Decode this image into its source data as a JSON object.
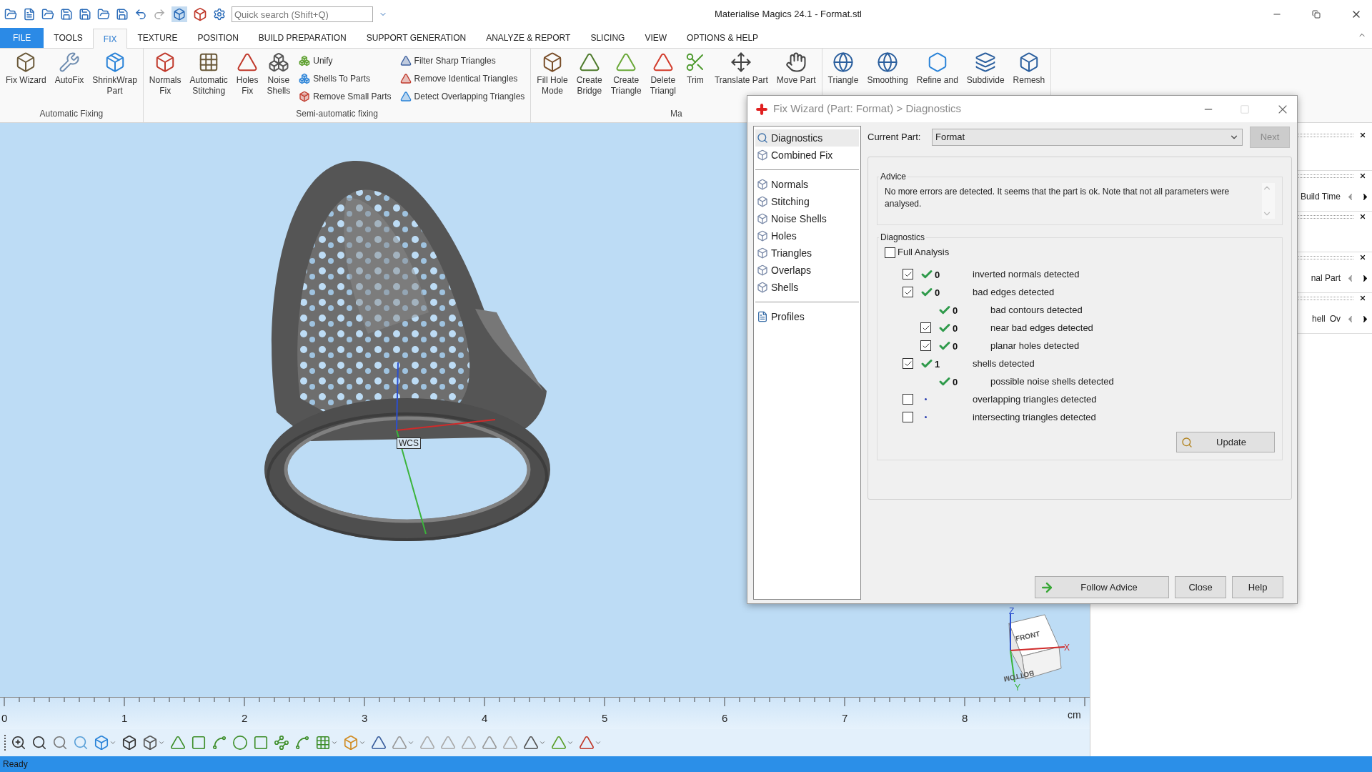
{
  "window": {
    "title": "Materialise Magics 24.1 - Format.stl"
  },
  "quick_search": {
    "placeholder": "Quick search (Shift+Q)"
  },
  "ribbon_tabs": [
    {
      "label": "FILE",
      "kind": "file",
      "selected": false
    },
    {
      "label": "TOOLS",
      "kind": "tab",
      "selected": false
    },
    {
      "label": "FIX",
      "kind": "tab",
      "selected": true
    },
    {
      "label": "TEXTURE",
      "kind": "tab",
      "selected": false
    },
    {
      "label": "POSITION",
      "kind": "tab",
      "selected": false
    },
    {
      "label": "BUILD PREPARATION",
      "kind": "tab",
      "selected": false
    },
    {
      "label": "SUPPORT GENERATION",
      "kind": "tab",
      "selected": false
    },
    {
      "label": "ANALYZE & REPORT",
      "kind": "tab",
      "selected": false
    },
    {
      "label": "SLICING",
      "kind": "tab",
      "selected": false
    },
    {
      "label": "VIEW",
      "kind": "tab",
      "selected": false
    },
    {
      "label": "OPTIONS & HELP",
      "kind": "tab",
      "selected": false
    }
  ],
  "ribbon_groups": [
    {
      "label": "Automatic Fixing",
      "items": [
        {
          "kind": "large",
          "label": "Fix Wizard"
        },
        {
          "kind": "large",
          "label": "AutoFix"
        },
        {
          "kind": "large",
          "label": "ShrinkWrap\nPart"
        }
      ]
    },
    {
      "label": "Semi-automatic fixing",
      "items": [
        {
          "kind": "large",
          "label": "Normals\nFix"
        },
        {
          "kind": "large",
          "label": "Automatic\nStitching"
        },
        {
          "kind": "large",
          "label": "Holes\nFix"
        },
        {
          "kind": "large",
          "label": "Noise\nShells"
        },
        {
          "kind": "small",
          "label": "Unify"
        },
        {
          "kind": "small",
          "label": "Shells To Parts"
        },
        {
          "kind": "small",
          "label": "Remove Small Parts"
        },
        {
          "kind": "small",
          "label": "Filter Sharp Triangles"
        },
        {
          "kind": "small",
          "label": "Remove Identical Triangles"
        },
        {
          "kind": "small",
          "label": "Detect Overlapping Triangles"
        }
      ]
    },
    {
      "label": "Ma",
      "items": [
        {
          "kind": "large",
          "label": "Fill Hole\nMode"
        },
        {
          "kind": "large",
          "label": "Create\nBridge"
        },
        {
          "kind": "large",
          "label": "Create\nTriangle"
        },
        {
          "kind": "large",
          "label": "Delete\nTriangl"
        },
        {
          "kind": "large",
          "label": "Trim"
        },
        {
          "kind": "large",
          "label": "Translate Part"
        },
        {
          "kind": "large",
          "label": "Move Part"
        }
      ]
    },
    {
      "items": [
        {
          "kind": "large",
          "label": "Triangle"
        },
        {
          "kind": "large",
          "label": "Smoothing"
        },
        {
          "kind": "large",
          "label": "Refine and"
        },
        {
          "kind": "large",
          "label": "Subdivide"
        },
        {
          "kind": "large",
          "label": "Remesh"
        }
      ]
    }
  ],
  "scene": {
    "axis_label": "WCS",
    "view_cube": {
      "front": "FRONT",
      "bottom": "BOTTOM",
      "z": "Z",
      "x": "X",
      "y": "Y"
    }
  },
  "ruler": {
    "labels": [
      "0",
      "1",
      "2",
      "3",
      "4",
      "5",
      "6",
      "7",
      "8"
    ],
    "unit": "cm"
  },
  "side_panels": [
    {
      "kind": "empty"
    },
    {
      "kind": "row",
      "texts": [
        "Build Time"
      ]
    },
    {
      "kind": "empty"
    },
    {
      "kind": "row",
      "texts": [
        "nal Part"
      ]
    },
    {
      "kind": "row",
      "texts": [
        "hell",
        "Ov"
      ]
    }
  ],
  "dialog": {
    "title": "Fix Wizard (Part: Format) > Diagnostics",
    "nav_sections": [
      [
        {
          "label": "Diagnostics",
          "selected": true
        },
        {
          "label": "Combined Fix",
          "selected": false
        }
      ],
      [
        {
          "label": "Normals",
          "selected": false
        },
        {
          "label": "Stitching",
          "selected": false
        },
        {
          "label": "Noise Shells",
          "selected": false
        },
        {
          "label": "Holes",
          "selected": false
        },
        {
          "label": "Triangles",
          "selected": false
        },
        {
          "label": "Overlaps",
          "selected": false
        },
        {
          "label": "Shells",
          "selected": false
        }
      ],
      [
        {
          "label": "Profiles",
          "selected": false
        }
      ]
    ],
    "current_part": {
      "label": "Current Part:",
      "value": "Format"
    },
    "next_button": {
      "label": "Next",
      "disabled": true
    },
    "advice": {
      "heading": "Advice",
      "text": "No more errors are detected. It seems that the part is ok. Note that not all parameters were analysed."
    },
    "diagnostics": {
      "heading": "Diagnostics",
      "full_analysis": {
        "label": "Full Analysis",
        "checked": false
      },
      "rows": [
        {
          "kind": "check",
          "checked": true,
          "passed": true,
          "count": "0",
          "label": "inverted normals detected"
        },
        {
          "kind": "check",
          "checked": true,
          "passed": true,
          "count": "0",
          "label": "bad edges detected",
          "children": [
            {
              "kind": "plain",
              "passed": true,
              "count": "0",
              "label": "bad contours detected"
            },
            {
              "kind": "check",
              "checked": true,
              "passed": true,
              "count": "0",
              "label": "near bad edges detected"
            },
            {
              "kind": "check",
              "checked": true,
              "passed": true,
              "count": "0",
              "label": "planar holes detected"
            }
          ]
        },
        {
          "kind": "check",
          "checked": true,
          "passed": true,
          "count": "1",
          "label": "shells detected",
          "children": [
            {
              "kind": "plain",
              "passed": true,
              "count": "0",
              "label": "possible noise shells detected"
            }
          ]
        },
        {
          "kind": "check",
          "checked": false,
          "passed": false,
          "label": "overlapping triangles detected"
        },
        {
          "kind": "check",
          "checked": false,
          "passed": false,
          "label": "intersecting triangles detected"
        }
      ],
      "update_button": "Update"
    },
    "buttons": [
      "Follow Advice",
      "Close",
      "Help"
    ]
  },
  "status_bar": {
    "text": "Ready"
  }
}
